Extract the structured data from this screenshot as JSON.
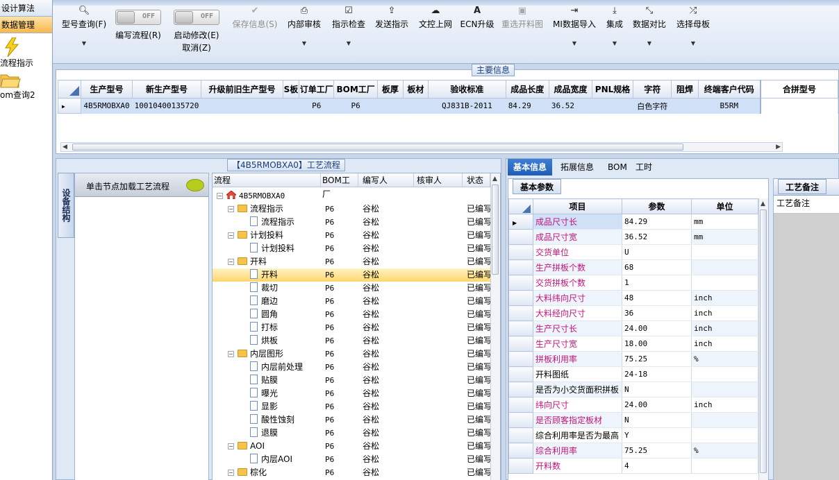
{
  "leftnav": {
    "groups": [
      "设计算法",
      "数据管理"
    ],
    "items": [
      {
        "label": "流程指示",
        "icon": "lightning-icon"
      },
      {
        "label": "om查询2",
        "icon": "folder-open-icon"
      }
    ]
  },
  "toolbar": {
    "buttons": [
      {
        "label": "型号查询(F)",
        "icon": "search-icon",
        "dropdown": true
      },
      {
        "label": "编写流程(R)",
        "toggle": "OFF"
      },
      {
        "label": "启动修改(E)",
        "toggle": "OFF",
        "sublabel": "取消(Z)"
      },
      {
        "label": "保存信息(S)",
        "icon": "check-icon",
        "disabled": true
      },
      {
        "label": "内部审核",
        "icon": "printer-icon",
        "dropdown": true
      },
      {
        "label": "指示检查",
        "icon": "checkbox-icon",
        "dropdown": true
      },
      {
        "label": "发送指示",
        "icon": "upload-icon"
      },
      {
        "label": "文控上网",
        "icon": "cloud-upload-icon"
      },
      {
        "label": "ECN升级",
        "icon": "font-icon"
      },
      {
        "label": "重选开料图",
        "icon": "image-icon",
        "disabled": true
      },
      {
        "label": "MI数据导入",
        "icon": "sign-in-icon",
        "dropdown": true
      },
      {
        "label": "集成",
        "icon": "download-icon",
        "dropdown": true
      },
      {
        "label": "数据对比",
        "icon": "compress-icon",
        "dropdown": true
      },
      {
        "label": "选择母板",
        "icon": "random-icon",
        "dropdown": true
      }
    ]
  },
  "main_info": {
    "title": "主要信息",
    "columns": [
      "生产型号",
      "新生产型号",
      "升级前旧生产型号",
      "S板",
      "订单工厂",
      "BOM工厂",
      "板厚",
      "板材",
      "验收标准",
      "成品长度",
      "成品宽度",
      "PNL规格",
      "字符",
      "阻焊",
      "终端客户代码",
      "合拼型号"
    ],
    "row": [
      "4B5RMOBXA0",
      "10010400135720",
      "",
      "",
      "P6",
      "P6",
      "",
      "",
      "QJ831B-2011",
      "84.29",
      "36.52",
      "",
      "白色字符",
      "",
      "B5RM",
      ""
    ]
  },
  "process_panel": {
    "title": "【4B5RMOBXA0】工艺流程",
    "equip_tab": "设备结构",
    "load_hint": "单击节点加载工艺流程",
    "tree_columns": [
      "流程",
      "BOM工厂",
      "编写人",
      "核审人",
      "状态"
    ],
    "root": "4B5RMOBXA0",
    "rows": [
      {
        "name": "流程指示",
        "level": 1,
        "type": "folder",
        "bom": "P6",
        "writer": "谷松",
        "status": "已编写"
      },
      {
        "name": "流程指示",
        "level": 2,
        "type": "doc",
        "bom": "P6",
        "writer": "谷松",
        "status": "已编写"
      },
      {
        "name": "计划投料",
        "level": 1,
        "type": "folder",
        "bom": "P6",
        "writer": "谷松",
        "status": "已编写"
      },
      {
        "name": "计划投料",
        "level": 2,
        "type": "doc",
        "bom": "P6",
        "writer": "谷松",
        "status": "已编写"
      },
      {
        "name": "开料",
        "level": 1,
        "type": "folder",
        "bom": "P6",
        "writer": "谷松",
        "status": "已编写"
      },
      {
        "name": "开料",
        "level": 2,
        "type": "doc",
        "bom": "P6",
        "writer": "谷松",
        "status": "已编写",
        "selected": true
      },
      {
        "name": "裁切",
        "level": 2,
        "type": "doc",
        "bom": "P6",
        "writer": "谷松",
        "status": "已编写"
      },
      {
        "name": "磨边",
        "level": 2,
        "type": "doc",
        "bom": "P6",
        "writer": "谷松",
        "status": "已编写"
      },
      {
        "name": "圆角",
        "level": 2,
        "type": "doc",
        "bom": "P6",
        "writer": "谷松",
        "status": "已编写"
      },
      {
        "name": "打标",
        "level": 2,
        "type": "doc",
        "bom": "P6",
        "writer": "谷松",
        "status": "已编写"
      },
      {
        "name": "烘板",
        "level": 2,
        "type": "doc",
        "bom": "P6",
        "writer": "谷松",
        "status": "已编写"
      },
      {
        "name": "内层图形",
        "level": 1,
        "type": "folder",
        "bom": "P6",
        "writer": "谷松",
        "status": "已编写"
      },
      {
        "name": "内层前处理",
        "level": 2,
        "type": "doc",
        "bom": "P6",
        "writer": "谷松",
        "status": "已编写"
      },
      {
        "name": "贴膜",
        "level": 2,
        "type": "doc",
        "bom": "P6",
        "writer": "谷松",
        "status": "已编写"
      },
      {
        "name": "曝光",
        "level": 2,
        "type": "doc",
        "bom": "P6",
        "writer": "谷松",
        "status": "已编写"
      },
      {
        "name": "显影",
        "level": 2,
        "type": "doc",
        "bom": "P6",
        "writer": "谷松",
        "status": "已编写"
      },
      {
        "name": "酸性蚀刻",
        "level": 2,
        "type": "doc",
        "bom": "P6",
        "writer": "谷松",
        "status": "已编写"
      },
      {
        "name": "退膜",
        "level": 2,
        "type": "doc",
        "bom": "P6",
        "writer": "谷松",
        "status": "已编写"
      },
      {
        "name": "AOI",
        "level": 1,
        "type": "folder",
        "bom": "P6",
        "writer": "谷松",
        "status": "已编写"
      },
      {
        "name": "内层AOI",
        "level": 2,
        "type": "doc",
        "bom": "P6",
        "writer": "谷松",
        "status": "已编写"
      },
      {
        "name": "棕化",
        "level": 1,
        "type": "folder",
        "bom": "P6",
        "writer": "谷松",
        "status": "已编写"
      }
    ]
  },
  "right_panel": {
    "tabs": [
      "基本信息",
      "拓展信息",
      "BOM",
      "工时"
    ],
    "basic_tab": "基本参数",
    "note_tab": "工艺备注",
    "note_label": "工艺备注",
    "param_columns": [
      "项目",
      "参数",
      "单位"
    ],
    "params": [
      {
        "item": "成品尺寸长",
        "value": "84.29",
        "unit": "mm",
        "pink": true
      },
      {
        "item": "成品尺寸宽",
        "value": "36.52",
        "unit": "mm",
        "pink": true
      },
      {
        "item": "交货单位",
        "value": "U",
        "unit": "",
        "pink": true
      },
      {
        "item": "生产拼板个数",
        "value": "68",
        "unit": "",
        "pink": true
      },
      {
        "item": "交货拼板个数",
        "value": "1",
        "unit": "",
        "pink": true
      },
      {
        "item": "大料纬向尺寸",
        "value": "48",
        "unit": "inch",
        "pink": true
      },
      {
        "item": "大料经向尺寸",
        "value": "36",
        "unit": "inch",
        "pink": true
      },
      {
        "item": "生产尺寸长",
        "value": "24.00",
        "unit": "inch",
        "pink": true
      },
      {
        "item": "生产尺寸宽",
        "value": "18.00",
        "unit": "inch",
        "pink": true
      },
      {
        "item": "拼板利用率",
        "value": "75.25",
        "unit": "%",
        "pink": true
      },
      {
        "item": "开料图纸",
        "value": "24-18",
        "unit": "",
        "pink": false
      },
      {
        "item": "是否为小交货面积拼板",
        "value": "N",
        "unit": "",
        "pink": false
      },
      {
        "item": "纬向尺寸",
        "value": "24.00",
        "unit": "inch",
        "pink": true
      },
      {
        "item": "是否顾客指定板材",
        "value": "N",
        "unit": "",
        "pink": true
      },
      {
        "item": "综合利用率是否为最高",
        "value": "Y",
        "unit": "",
        "pink": false
      },
      {
        "item": "综合利用率",
        "value": "75.25",
        "unit": "%",
        "pink": true
      },
      {
        "item": "开料数",
        "value": "4",
        "unit": "",
        "pink": true
      }
    ]
  }
}
